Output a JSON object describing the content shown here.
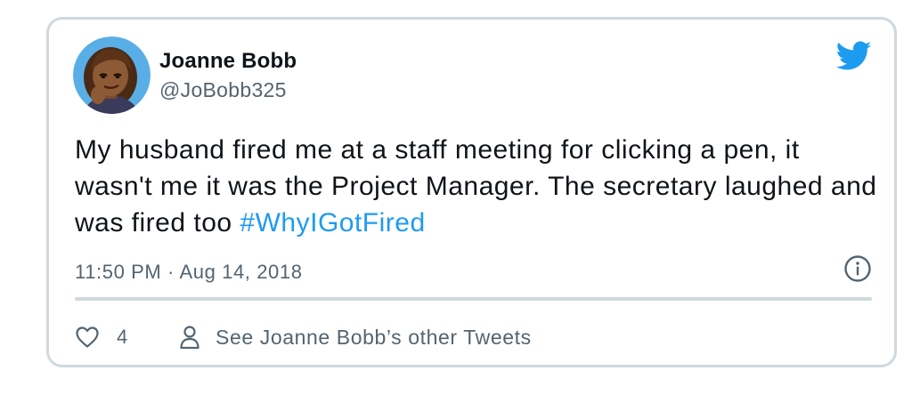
{
  "tweet": {
    "author_name": "Joanne Bobb",
    "author_handle": "@JoBobb325",
    "text": "My husband fired me at a staff meeting for clicking a pen, it wasn't me it was the Project Manager. The secretary laughed and was fired too ",
    "hashtag": "#WhyIGotFired",
    "timestamp": "11:50 PM · Aug 14, 2018",
    "like_count": "4",
    "other_tweets_label": "See Joanne Bobb’s other Tweets"
  },
  "icons": {
    "brand": "twitter-bird-icon",
    "info": "info-icon",
    "like": "heart-icon",
    "profile": "person-icon",
    "avatar": "bitmoji-avatar"
  },
  "colors": {
    "accent": "#1d9bf0",
    "text": "#0f1419",
    "secondary_text": "#536471",
    "border": "#cfd9de"
  }
}
